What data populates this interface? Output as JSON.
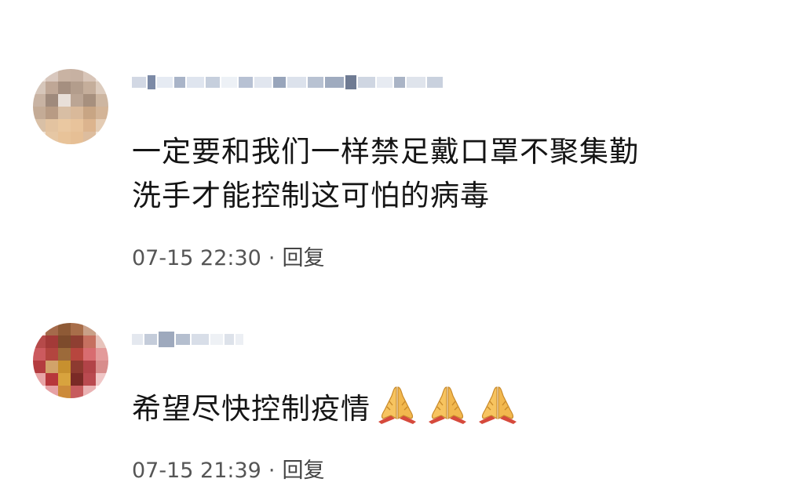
{
  "comments": [
    {
      "text_line1": "一定要和我们一样禁足戴口罩不聚集勤",
      "text_line2": "洗手才能控制这可怕的病毒",
      "time": "07-15 22:30",
      "separator": "·",
      "reply_label": "回复"
    },
    {
      "text_line1": "希望尽快控制疫情",
      "emoji_icon": "folded-hands-icon",
      "emoji_count": 3,
      "time": "07-15 21:39",
      "separator": "·",
      "reply_label": "回复"
    }
  ]
}
